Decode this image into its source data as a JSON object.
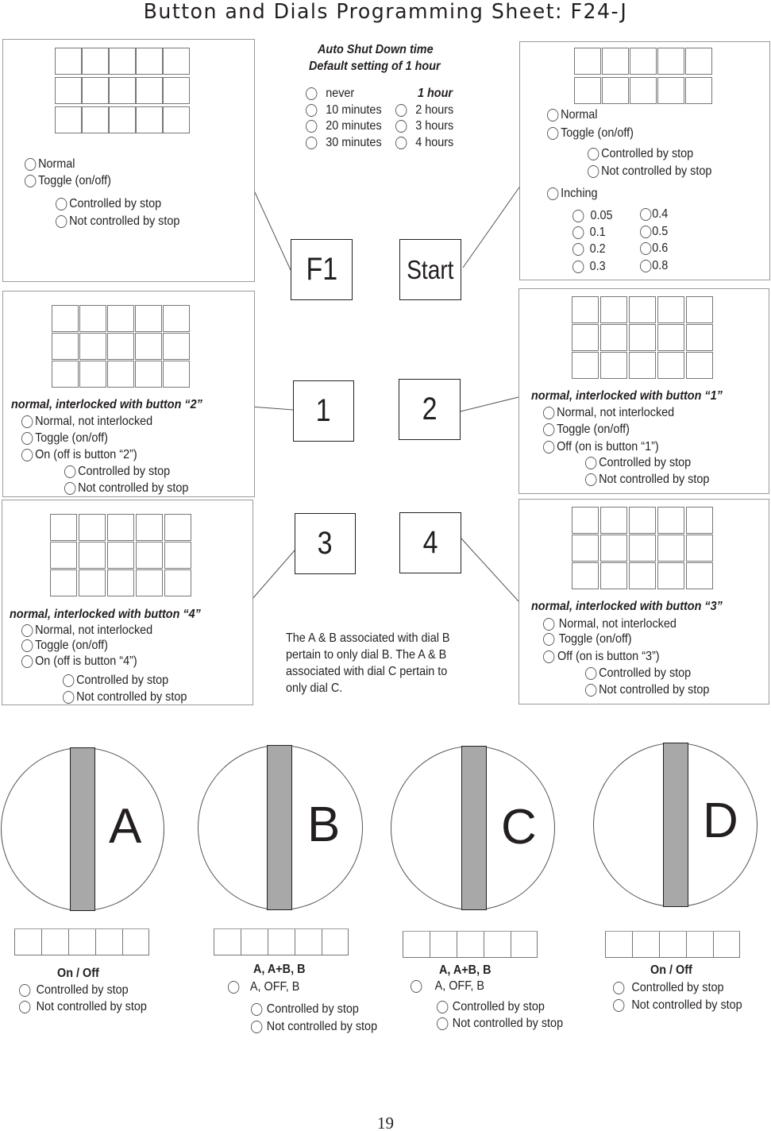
{
  "title": "Button and Dials Programming Sheet:  F24-J",
  "page_number": "19",
  "auto_shutdown": {
    "heading_line1": "Auto Shut Down time",
    "heading_line2": "Default setting of 1 hour",
    "left_options": [
      "never",
      "10 minutes",
      "20 minutes",
      "30 minutes"
    ],
    "right_default": "1 hour",
    "right_options": [
      "2 hours",
      "3 hours",
      "4 hours"
    ]
  },
  "buttons": {
    "f1": "F1",
    "start": "Start",
    "b1": "1",
    "b2": "2",
    "b3": "3",
    "b4": "4"
  },
  "panel_f1": {
    "options": [
      "Normal",
      "Toggle (on/off)"
    ],
    "sub_options": [
      "Controlled by stop",
      "Not controlled by stop"
    ]
  },
  "panel_start": {
    "options": [
      "Normal",
      "Toggle (on/off)"
    ],
    "sub_options": [
      "Controlled by stop",
      "Not controlled by stop"
    ],
    "inching_label": "Inching",
    "inching_left": [
      "0.05",
      "0.1",
      "0.2",
      "0.3"
    ],
    "inching_right": [
      "0.4",
      "0.5",
      "0.6",
      "0.8"
    ]
  },
  "panel_1": {
    "heading": "normal, interlocked with button “2”",
    "options": [
      "Normal, not interlocked",
      "Toggle (on/off)",
      "On (off is button “2”)"
    ],
    "sub_options": [
      "Controlled by stop",
      "Not controlled by stop"
    ]
  },
  "panel_2": {
    "heading": "normal, interlocked with button “1”",
    "options": [
      "Normal, not interlocked",
      "Toggle (on/off)",
      "Off (on is button “1”)"
    ],
    "sub_options": [
      "Controlled by stop",
      "Not controlled by stop"
    ]
  },
  "panel_3": {
    "heading": "normal, interlocked with button “4”",
    "options": [
      "Normal, not interlocked",
      "Toggle (on/off)",
      "On (off is button “4”)"
    ],
    "sub_options": [
      "Controlled by stop",
      "Not controlled by stop"
    ]
  },
  "panel_4": {
    "heading": "normal, interlocked with button “3”",
    "options": [
      "Normal, not interlocked",
      "Toggle (on/off)",
      "Off (on is button “3”)"
    ],
    "sub_options": [
      "Controlled by stop",
      "Not controlled by stop"
    ]
  },
  "note": "The A & B associated with dial B pertain to only dial B. The A & B associated with dial C pertain to only dial C.",
  "dials": {
    "a": {
      "letter": "A",
      "heading": "On / Off",
      "options": [
        "Controlled by stop",
        "Not controlled by stop"
      ]
    },
    "b": {
      "letter": "B",
      "heading": "A, A+B, B",
      "mode_option": "A, OFF, B",
      "options": [
        "Controlled by stop",
        "Not controlled by stop"
      ]
    },
    "c": {
      "letter": "C",
      "heading": "A, A+B, B",
      "mode_option": "A, OFF, B",
      "options": [
        "Controlled by stop",
        "Not controlled by stop"
      ]
    },
    "d": {
      "letter": "D",
      "heading": "On / Off",
      "options": [
        "Controlled by stop",
        "Not controlled by stop"
      ]
    }
  }
}
